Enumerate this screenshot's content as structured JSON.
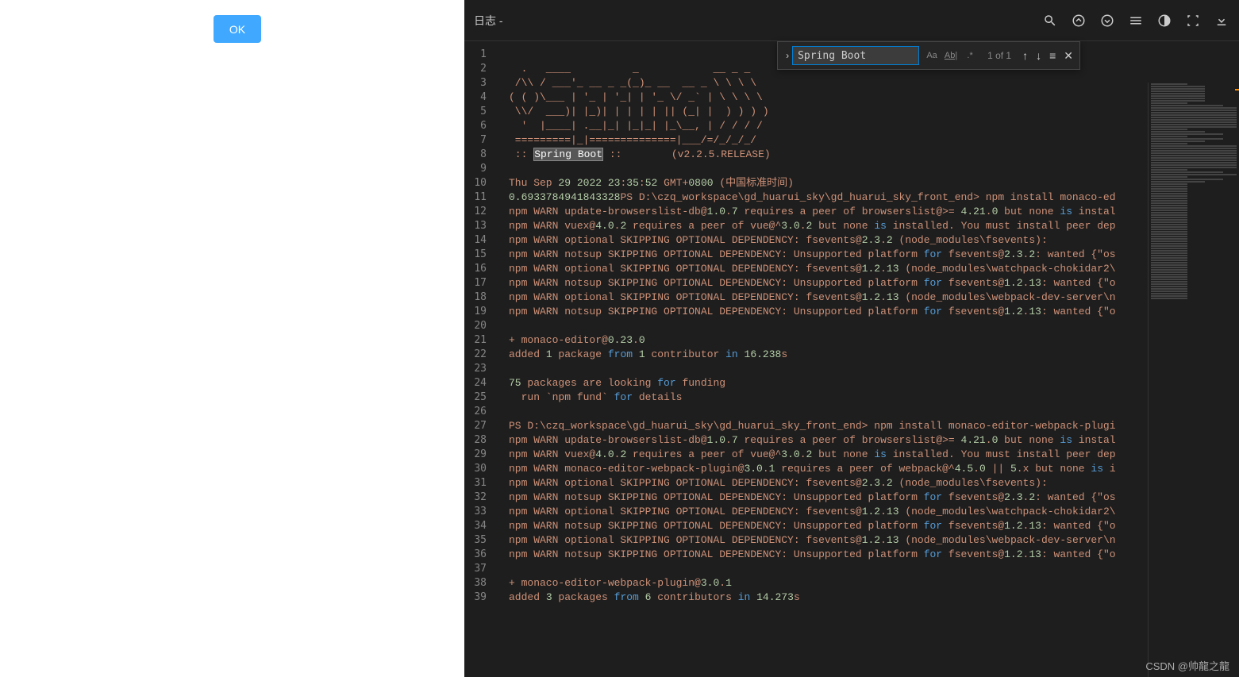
{
  "buttons": {
    "ok": "OK"
  },
  "title": "日志 -",
  "find": {
    "value": "Spring Boot",
    "count": "1 of 1",
    "aa": "Aa",
    "ab": "Ab|",
    "re": ".*"
  },
  "lines": [
    {
      "n": "1",
      "segs": [
        {
          "t": "",
          "c": "txt"
        }
      ]
    },
    {
      "n": "2",
      "segs": [
        {
          "t": "  .   ____          _            __ _ _",
          "c": "txt"
        }
      ]
    },
    {
      "n": "3",
      "segs": [
        {
          "t": " /\\\\ / ___'_ __ _ _(_)_ __  __ _ \\ \\ \\ \\",
          "c": "txt"
        }
      ]
    },
    {
      "n": "4",
      "segs": [
        {
          "t": "( ( )\\___ | '_ | '_| | '_ \\/ _` | \\ \\ \\ \\",
          "c": "txt"
        }
      ]
    },
    {
      "n": "5",
      "segs": [
        {
          "t": " \\\\/  ___)| |_)| | | | | || (_| |  ) ) ) )",
          "c": "txt"
        }
      ]
    },
    {
      "n": "6",
      "segs": [
        {
          "t": "  '  |____| .__|_| |_|_| |_\\__, | / / / /",
          "c": "txt"
        }
      ]
    },
    {
      "n": "7",
      "segs": [
        {
          "t": " =========|_|==============|___/=/_/_/_/",
          "c": "txt"
        }
      ]
    },
    {
      "n": "8",
      "segs": [
        {
          "t": " :: ",
          "c": "txt"
        },
        {
          "t": "Spring Boot",
          "c": "hl"
        },
        {
          "t": " ::        (v2.2.5.RELEASE)",
          "c": "txt"
        }
      ]
    },
    {
      "n": "9",
      "segs": [
        {
          "t": "",
          "c": "txt"
        }
      ]
    },
    {
      "n": "10",
      "segs": [
        {
          "t": "Thu Sep ",
          "c": "txt"
        },
        {
          "t": "29",
          "c": "num"
        },
        {
          "t": " ",
          "c": "txt"
        },
        {
          "t": "2022",
          "c": "num"
        },
        {
          "t": " ",
          "c": "txt"
        },
        {
          "t": "23",
          "c": "num"
        },
        {
          "t": ":",
          "c": "txt"
        },
        {
          "t": "35",
          "c": "num"
        },
        {
          "t": ":",
          "c": "txt"
        },
        {
          "t": "52",
          "c": "num"
        },
        {
          "t": " GMT+",
          "c": "txt"
        },
        {
          "t": "0800",
          "c": "num"
        },
        {
          "t": " (中国标准时间)",
          "c": "txt"
        }
      ]
    },
    {
      "n": "11",
      "segs": [
        {
          "t": "0.6933784941843328",
          "c": "num"
        },
        {
          "t": "PS D:\\czq_workspace\\gd_huarui_sky\\gd_huarui_sky_front_end> npm install monaco-ed",
          "c": "txt"
        }
      ]
    },
    {
      "n": "12",
      "segs": [
        {
          "t": "npm WARN update-browserslist-db@",
          "c": "txt"
        },
        {
          "t": "1.0",
          "c": "num"
        },
        {
          "t": ".",
          "c": "txt"
        },
        {
          "t": "7",
          "c": "num"
        },
        {
          "t": " requires a peer of browserslist@>= ",
          "c": "txt"
        },
        {
          "t": "4.21",
          "c": "num"
        },
        {
          "t": ".",
          "c": "txt"
        },
        {
          "t": "0",
          "c": "num"
        },
        {
          "t": " but none ",
          "c": "txt"
        },
        {
          "t": "is",
          "c": "kw"
        },
        {
          "t": " instal",
          "c": "txt"
        }
      ]
    },
    {
      "n": "13",
      "segs": [
        {
          "t": "npm WARN vuex@",
          "c": "txt"
        },
        {
          "t": "4.0",
          "c": "num"
        },
        {
          "t": ".",
          "c": "txt"
        },
        {
          "t": "2",
          "c": "num"
        },
        {
          "t": " requires a peer of vue@^",
          "c": "txt"
        },
        {
          "t": "3.0",
          "c": "num"
        },
        {
          "t": ".",
          "c": "txt"
        },
        {
          "t": "2",
          "c": "num"
        },
        {
          "t": " but none ",
          "c": "txt"
        },
        {
          "t": "is",
          "c": "kw"
        },
        {
          "t": " installed. You must install peer dep",
          "c": "txt"
        }
      ]
    },
    {
      "n": "14",
      "segs": [
        {
          "t": "npm WARN optional SKIPPING OPTIONAL DEPENDENCY: fsevents@",
          "c": "txt"
        },
        {
          "t": "2.3",
          "c": "num"
        },
        {
          "t": ".",
          "c": "txt"
        },
        {
          "t": "2",
          "c": "num"
        },
        {
          "t": " (node_modules\\fsevents):",
          "c": "txt"
        }
      ]
    },
    {
      "n": "15",
      "segs": [
        {
          "t": "npm WARN notsup SKIPPING OPTIONAL DEPENDENCY: Unsupported platform ",
          "c": "txt"
        },
        {
          "t": "for",
          "c": "kw"
        },
        {
          "t": " fsevents@",
          "c": "txt"
        },
        {
          "t": "2.3",
          "c": "num"
        },
        {
          "t": ".",
          "c": "txt"
        },
        {
          "t": "2",
          "c": "num"
        },
        {
          "t": ": wanted {",
          "c": "txt"
        },
        {
          "t": "\"os",
          "c": "str"
        }
      ]
    },
    {
      "n": "16",
      "segs": [
        {
          "t": "npm WARN optional SKIPPING OPTIONAL DEPENDENCY: fsevents@",
          "c": "txt"
        },
        {
          "t": "1.2",
          "c": "num"
        },
        {
          "t": ".",
          "c": "txt"
        },
        {
          "t": "13",
          "c": "num"
        },
        {
          "t": " (node_modules\\watchpack-chokidar2\\",
          "c": "txt"
        }
      ]
    },
    {
      "n": "17",
      "segs": [
        {
          "t": "npm WARN notsup SKIPPING OPTIONAL DEPENDENCY: Unsupported platform ",
          "c": "txt"
        },
        {
          "t": "for",
          "c": "kw"
        },
        {
          "t": " fsevents@",
          "c": "txt"
        },
        {
          "t": "1.2",
          "c": "num"
        },
        {
          "t": ".",
          "c": "txt"
        },
        {
          "t": "13",
          "c": "num"
        },
        {
          "t": ": wanted {",
          "c": "txt"
        },
        {
          "t": "\"o",
          "c": "str"
        }
      ]
    },
    {
      "n": "18",
      "segs": [
        {
          "t": "npm WARN optional SKIPPING OPTIONAL DEPENDENCY: fsevents@",
          "c": "txt"
        },
        {
          "t": "1.2",
          "c": "num"
        },
        {
          "t": ".",
          "c": "txt"
        },
        {
          "t": "13",
          "c": "num"
        },
        {
          "t": " (node_modules\\webpack-dev-server\\n",
          "c": "txt"
        }
      ]
    },
    {
      "n": "19",
      "segs": [
        {
          "t": "npm WARN notsup SKIPPING OPTIONAL DEPENDENCY: Unsupported platform ",
          "c": "txt"
        },
        {
          "t": "for",
          "c": "kw"
        },
        {
          "t": " fsevents@",
          "c": "txt"
        },
        {
          "t": "1.2",
          "c": "num"
        },
        {
          "t": ".",
          "c": "txt"
        },
        {
          "t": "13",
          "c": "num"
        },
        {
          "t": ": wanted {",
          "c": "txt"
        },
        {
          "t": "\"o",
          "c": "str"
        }
      ]
    },
    {
      "n": "20",
      "segs": [
        {
          "t": "",
          "c": "txt"
        }
      ]
    },
    {
      "n": "21",
      "segs": [
        {
          "t": "+ monaco-editor@",
          "c": "txt"
        },
        {
          "t": "0.23",
          "c": "num"
        },
        {
          "t": ".",
          "c": "txt"
        },
        {
          "t": "0",
          "c": "num"
        }
      ]
    },
    {
      "n": "22",
      "segs": [
        {
          "t": "added ",
          "c": "txt"
        },
        {
          "t": "1",
          "c": "num"
        },
        {
          "t": " package ",
          "c": "txt"
        },
        {
          "t": "from",
          "c": "kw"
        },
        {
          "t": " ",
          "c": "txt"
        },
        {
          "t": "1",
          "c": "num"
        },
        {
          "t": " contributor ",
          "c": "txt"
        },
        {
          "t": "in",
          "c": "kw"
        },
        {
          "t": " ",
          "c": "txt"
        },
        {
          "t": "16.238",
          "c": "num"
        },
        {
          "t": "s",
          "c": "txt"
        }
      ]
    },
    {
      "n": "23",
      "segs": [
        {
          "t": "",
          "c": "txt"
        }
      ]
    },
    {
      "n": "24",
      "segs": [
        {
          "t": "75",
          "c": "num"
        },
        {
          "t": " packages are looking ",
          "c": "txt"
        },
        {
          "t": "for",
          "c": "kw"
        },
        {
          "t": " funding",
          "c": "txt"
        }
      ]
    },
    {
      "n": "25",
      "segs": [
        {
          "t": "  run `npm fund` ",
          "c": "txt"
        },
        {
          "t": "for",
          "c": "kw"
        },
        {
          "t": " details",
          "c": "txt"
        }
      ]
    },
    {
      "n": "26",
      "segs": [
        {
          "t": "",
          "c": "txt"
        }
      ]
    },
    {
      "n": "27",
      "segs": [
        {
          "t": "PS D:\\czq_workspace\\gd_huarui_sky\\gd_huarui_sky_front_end> npm install monaco-editor-webpack-plugi",
          "c": "txt"
        }
      ]
    },
    {
      "n": "28",
      "segs": [
        {
          "t": "npm WARN update-browserslist-db@",
          "c": "txt"
        },
        {
          "t": "1.0",
          "c": "num"
        },
        {
          "t": ".",
          "c": "txt"
        },
        {
          "t": "7",
          "c": "num"
        },
        {
          "t": " requires a peer of browserslist@>= ",
          "c": "txt"
        },
        {
          "t": "4.21",
          "c": "num"
        },
        {
          "t": ".",
          "c": "txt"
        },
        {
          "t": "0",
          "c": "num"
        },
        {
          "t": " but none ",
          "c": "txt"
        },
        {
          "t": "is",
          "c": "kw"
        },
        {
          "t": " instal",
          "c": "txt"
        }
      ]
    },
    {
      "n": "29",
      "segs": [
        {
          "t": "npm WARN vuex@",
          "c": "txt"
        },
        {
          "t": "4.0",
          "c": "num"
        },
        {
          "t": ".",
          "c": "txt"
        },
        {
          "t": "2",
          "c": "num"
        },
        {
          "t": " requires a peer of vue@^",
          "c": "txt"
        },
        {
          "t": "3.0",
          "c": "num"
        },
        {
          "t": ".",
          "c": "txt"
        },
        {
          "t": "2",
          "c": "num"
        },
        {
          "t": " but none ",
          "c": "txt"
        },
        {
          "t": "is",
          "c": "kw"
        },
        {
          "t": " installed. You must install peer dep",
          "c": "txt"
        }
      ]
    },
    {
      "n": "30",
      "segs": [
        {
          "t": "npm WARN monaco-editor-webpack-plugin@",
          "c": "txt"
        },
        {
          "t": "3.0",
          "c": "num"
        },
        {
          "t": ".",
          "c": "txt"
        },
        {
          "t": "1",
          "c": "num"
        },
        {
          "t": " requires a peer of webpack@^",
          "c": "txt"
        },
        {
          "t": "4.5",
          "c": "num"
        },
        {
          "t": ".",
          "c": "txt"
        },
        {
          "t": "0",
          "c": "num"
        },
        {
          "t": " || ",
          "c": "txt"
        },
        {
          "t": "5",
          "c": "num"
        },
        {
          "t": ".x but none ",
          "c": "txt"
        },
        {
          "t": "is",
          "c": "kw"
        },
        {
          "t": " i",
          "c": "txt"
        }
      ]
    },
    {
      "n": "31",
      "segs": [
        {
          "t": "npm WARN optional SKIPPING OPTIONAL DEPENDENCY: fsevents@",
          "c": "txt"
        },
        {
          "t": "2.3",
          "c": "num"
        },
        {
          "t": ".",
          "c": "txt"
        },
        {
          "t": "2",
          "c": "num"
        },
        {
          "t": " (node_modules\\fsevents):",
          "c": "txt"
        }
      ]
    },
    {
      "n": "32",
      "segs": [
        {
          "t": "npm WARN notsup SKIPPING OPTIONAL DEPENDENCY: Unsupported platform ",
          "c": "txt"
        },
        {
          "t": "for",
          "c": "kw"
        },
        {
          "t": " fsevents@",
          "c": "txt"
        },
        {
          "t": "2.3",
          "c": "num"
        },
        {
          "t": ".",
          "c": "txt"
        },
        {
          "t": "2",
          "c": "num"
        },
        {
          "t": ": wanted {",
          "c": "txt"
        },
        {
          "t": "\"os",
          "c": "str"
        }
      ]
    },
    {
      "n": "33",
      "segs": [
        {
          "t": "npm WARN optional SKIPPING OPTIONAL DEPENDENCY: fsevents@",
          "c": "txt"
        },
        {
          "t": "1.2",
          "c": "num"
        },
        {
          "t": ".",
          "c": "txt"
        },
        {
          "t": "13",
          "c": "num"
        },
        {
          "t": " (node_modules\\watchpack-chokidar2\\",
          "c": "txt"
        }
      ]
    },
    {
      "n": "34",
      "segs": [
        {
          "t": "npm WARN notsup SKIPPING OPTIONAL DEPENDENCY: Unsupported platform ",
          "c": "txt"
        },
        {
          "t": "for",
          "c": "kw"
        },
        {
          "t": " fsevents@",
          "c": "txt"
        },
        {
          "t": "1.2",
          "c": "num"
        },
        {
          "t": ".",
          "c": "txt"
        },
        {
          "t": "13",
          "c": "num"
        },
        {
          "t": ": wanted {",
          "c": "txt"
        },
        {
          "t": "\"o",
          "c": "str"
        }
      ]
    },
    {
      "n": "35",
      "segs": [
        {
          "t": "npm WARN optional SKIPPING OPTIONAL DEPENDENCY: fsevents@",
          "c": "txt"
        },
        {
          "t": "1.2",
          "c": "num"
        },
        {
          "t": ".",
          "c": "txt"
        },
        {
          "t": "13",
          "c": "num"
        },
        {
          "t": " (node_modules\\webpack-dev-server\\n",
          "c": "txt"
        }
      ]
    },
    {
      "n": "36",
      "segs": [
        {
          "t": "npm WARN notsup SKIPPING OPTIONAL DEPENDENCY: Unsupported platform ",
          "c": "txt"
        },
        {
          "t": "for",
          "c": "kw"
        },
        {
          "t": " fsevents@",
          "c": "txt"
        },
        {
          "t": "1.2",
          "c": "num"
        },
        {
          "t": ".",
          "c": "txt"
        },
        {
          "t": "13",
          "c": "num"
        },
        {
          "t": ": wanted {",
          "c": "txt"
        },
        {
          "t": "\"o",
          "c": "str"
        }
      ]
    },
    {
      "n": "37",
      "segs": [
        {
          "t": "",
          "c": "txt"
        }
      ]
    },
    {
      "n": "38",
      "segs": [
        {
          "t": "+ monaco-editor-webpack-plugin@",
          "c": "txt"
        },
        {
          "t": "3.0",
          "c": "num"
        },
        {
          "t": ".",
          "c": "txt"
        },
        {
          "t": "1",
          "c": "num"
        }
      ]
    },
    {
      "n": "39",
      "segs": [
        {
          "t": "added ",
          "c": "txt"
        },
        {
          "t": "3",
          "c": "num"
        },
        {
          "t": " packages ",
          "c": "txt"
        },
        {
          "t": "from",
          "c": "kw"
        },
        {
          "t": " ",
          "c": "txt"
        },
        {
          "t": "6",
          "c": "num"
        },
        {
          "t": " contributors ",
          "c": "txt"
        },
        {
          "t": "in",
          "c": "kw"
        },
        {
          "t": " ",
          "c": "txt"
        },
        {
          "t": "14.273",
          "c": "num"
        },
        {
          "t": "s",
          "c": "txt"
        }
      ]
    }
  ],
  "watermark": "CSDN @帅龍之龍",
  "minimap_widths": [
    "w40",
    "w60",
    "w60",
    "w60",
    "w60",
    "w60",
    "w60",
    "w60",
    "w40",
    "w80",
    "w100",
    "w100",
    "w100",
    "w100",
    "w100",
    "w100",
    "w100",
    "w100",
    "w100",
    "w40",
    "w60",
    "w80",
    "w40",
    "w80",
    "w60",
    "w40",
    "w100",
    "w100",
    "w100",
    "w100",
    "w100",
    "w100",
    "w100",
    "w100",
    "w100",
    "w100",
    "w40",
    "w80",
    "w100",
    "w40",
    "w80",
    "w60",
    "w40",
    "w40",
    "w40",
    "w40",
    "w40",
    "w40",
    "w40",
    "w40",
    "w40",
    "w40",
    "w40",
    "w40",
    "w40",
    "w40",
    "w40",
    "w40",
    "w40",
    "w40",
    "w40",
    "w40",
    "w40",
    "w40",
    "w40",
    "w40",
    "w40",
    "w40",
    "w40",
    "w40",
    "w40",
    "w40",
    "w40",
    "w40",
    "w40",
    "w40",
    "w40",
    "w40",
    "w40",
    "w40",
    "w40",
    "w40",
    "w40",
    "w40",
    "w40",
    "w40",
    "w40",
    "w40",
    "w40",
    "w40",
    "w40"
  ]
}
